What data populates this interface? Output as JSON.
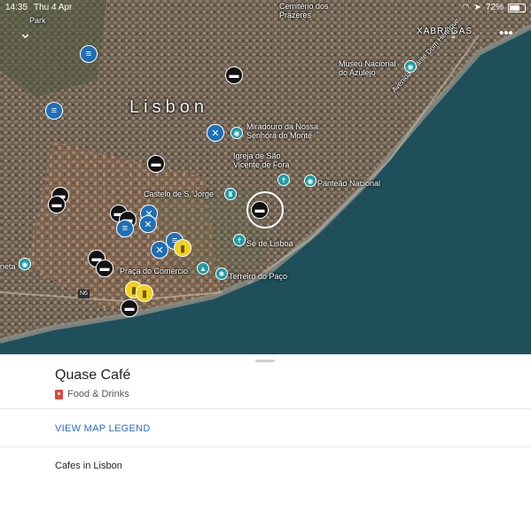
{
  "status": {
    "time": "14:35",
    "date": "Thu 4 Apr",
    "battery": "72%"
  },
  "map": {
    "city_label": "Lisbon",
    "labels": [
      "Cemitério dos Prazeres",
      "Park",
      "XABREGAS",
      "Museu Nacional do Azulejo",
      "Miradouro da Nossa Senhora do Monte",
      "Igreja de São Vicente de Fora",
      "Panteão Nacional",
      "Castelo de S. Jorge",
      "Sé de Lisboa",
      "Praça do Comércio",
      "Terreiro do Paço",
      "Avenida Infante Dom Henrique",
      "N6",
      "neta"
    ]
  },
  "sheet": {
    "place_title": "Quase Café",
    "category": "Food & Drinks",
    "legend_link": "VIEW MAP LEGEND",
    "list_title": "Cafes in Lisbon"
  },
  "colors": {
    "link": "#2a6cc8",
    "pin_blue": "#1e6fb8",
    "pin_yellow": "#f2d11b",
    "category_red": "#e0453a"
  }
}
